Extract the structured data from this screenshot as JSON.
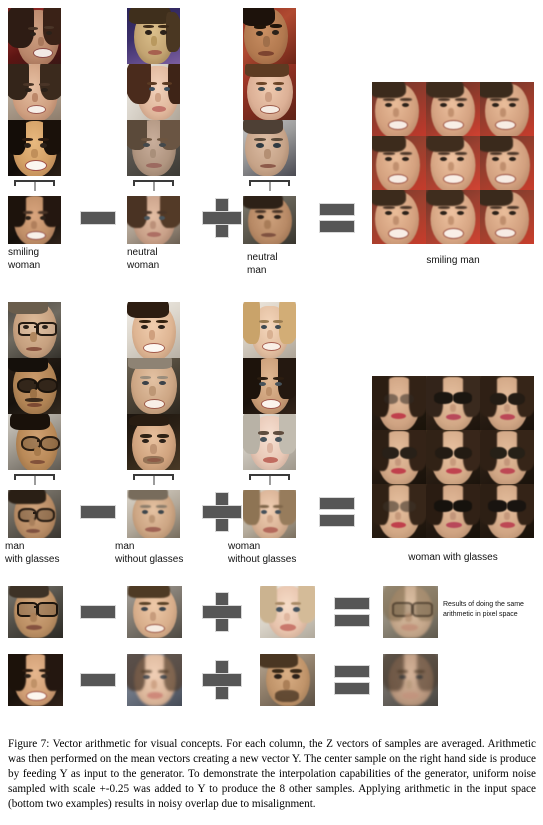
{
  "figure": {
    "caption_prefix": "Figure 7:",
    "caption": "Figure 7:  Vector arithmetic for visual concepts.  For each column, the Z vectors of samples are averaged. Arithmetic was then performed on the mean vectors creating a new vector Y. The center sample on the right hand side is produce by feeding Y as input to the generator.  To demonstrate the interpolation capabilities of the generator, uniform noise sampled with scale +-0.25 was added to Y to produce the 8 other samples. Applying arithmetic in the input space (bottom two examples) results in noisy overlap due to misalignment."
  },
  "rows": [
    {
      "id": "smiling-man-row",
      "terms": [
        {
          "label": "smiling\nwoman",
          "samples": 3
        },
        {
          "label": "neutral\nwoman",
          "samples": 3
        },
        {
          "label": "neutral\nman",
          "samples": 3
        }
      ],
      "operators": [
        "minus",
        "plus",
        "equals"
      ],
      "result": {
        "label": "smiling man",
        "grid": "3x3"
      }
    },
    {
      "id": "woman-with-glasses-row",
      "terms": [
        {
          "label": "man\nwith glasses",
          "samples": 3
        },
        {
          "label": "man\nwithout glasses",
          "samples": 3
        },
        {
          "label": "woman\nwithout glasses",
          "samples": 3
        }
      ],
      "operators": [
        "minus",
        "plus",
        "equals"
      ],
      "result": {
        "label": "woman with glasses",
        "grid": "3x3"
      }
    },
    {
      "id": "pixel-space-row-1",
      "terms": [
        {
          "label": "",
          "samples": 1
        },
        {
          "label": "",
          "samples": 1
        },
        {
          "label": "",
          "samples": 1
        }
      ],
      "operators": [
        "minus",
        "plus",
        "equals"
      ],
      "result": {
        "label": "",
        "grid": "1x1"
      }
    },
    {
      "id": "pixel-space-row-2",
      "terms": [
        {
          "label": "",
          "samples": 1
        },
        {
          "label": "",
          "samples": 1
        },
        {
          "label": "",
          "samples": 1
        }
      ],
      "operators": [
        "minus",
        "plus",
        "equals"
      ],
      "result": {
        "label": "",
        "grid": "1x1"
      }
    }
  ],
  "annotation": {
    "pixel_space_note": "Results of doing the same\narithmetic in pixel space"
  },
  "labels": {
    "r1c1": "smiling\nwoman",
    "r1c2": "neutral\nwoman",
    "r1c3": "neutral\nman",
    "r1res": "smiling man",
    "r2c1": "man\nwith glasses",
    "r2c2": "man\nwithout glasses",
    "r2c3": "woman\nwithout glasses",
    "r2res": "woman with glasses"
  },
  "colors": {
    "operator": "#565656",
    "operator_outline": "#d8d8d8",
    "brace": "#3a3a3a",
    "text": "#111111",
    "background": "#ffffff"
  }
}
